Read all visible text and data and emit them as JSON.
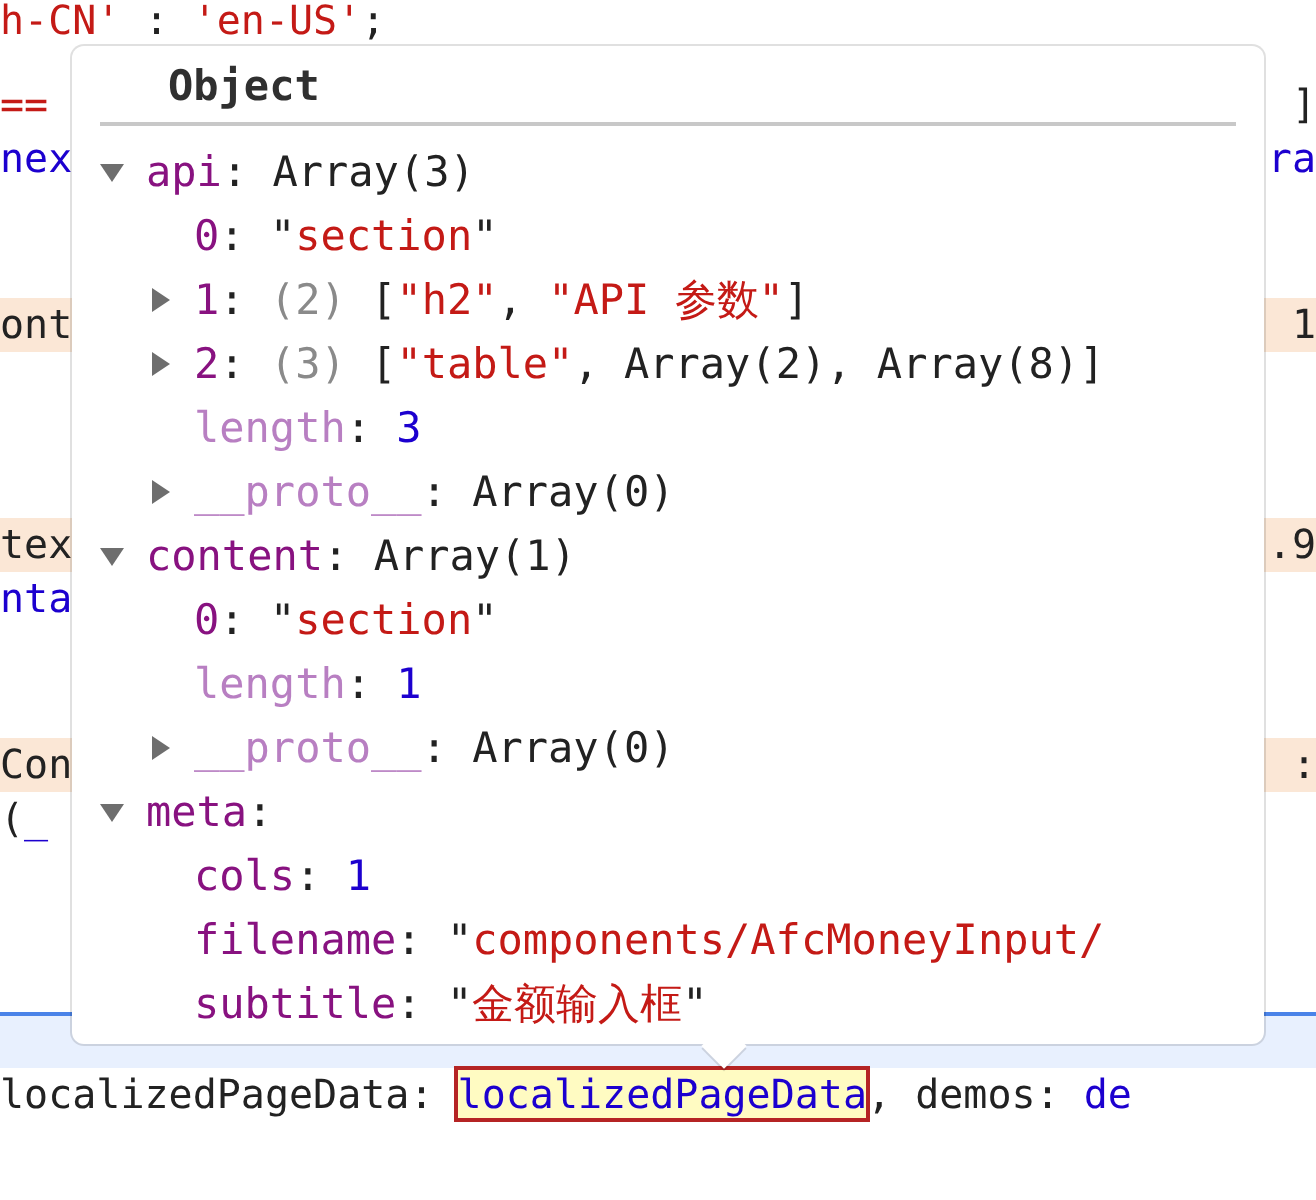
{
  "editor_lines": [
    {
      "kind": "plain",
      "left": [
        {
          "text": "h-CN'",
          "kind": "string"
        },
        {
          "text": " : ",
          "kind": "plain"
        },
        {
          "text": "'en-US'",
          "kind": "string"
        },
        {
          "text": ";",
          "kind": "plain"
        }
      ]
    },
    {
      "kind": "plain",
      "left": [
        {
          "text": "==",
          "kind": "string"
        }
      ],
      "right": [
        {
          "text": "]",
          "kind": "plain"
        }
      ]
    },
    {
      "kind": "plain",
      "left": [
        {
          "text": "nex",
          "kind": "ident"
        }
      ],
      "right": [
        {
          "text": "ra",
          "kind": "ident"
        }
      ]
    },
    {
      "kind": "plain"
    },
    {
      "kind": "plain"
    },
    {
      "kind": "changed",
      "left": [
        {
          "text": "ont",
          "kind": "plain"
        }
      ],
      "right": [
        {
          "text": "1",
          "kind": "plain"
        }
      ]
    },
    {
      "kind": "plain"
    },
    {
      "kind": "plain"
    },
    {
      "kind": "plain"
    },
    {
      "kind": "changed",
      "left": [
        {
          "text": "tex",
          "kind": "plain"
        }
      ],
      "right": [
        {
          "text": ".9",
          "kind": "plain"
        }
      ]
    },
    {
      "kind": "plain",
      "left": [
        {
          "text": "nta",
          "kind": "ident"
        }
      ]
    },
    {
      "kind": "plain"
    },
    {
      "kind": "plain"
    },
    {
      "kind": "changed",
      "left": [
        {
          "text": "Con",
          "kind": "plain"
        }
      ],
      "right": [
        {
          "text": ":",
          "kind": "plain"
        }
      ]
    },
    {
      "kind": "plain",
      "left": [
        {
          "text": "(",
          "kind": "plain"
        },
        {
          "text": "_",
          "kind": "ident"
        }
      ]
    },
    {
      "kind": "plain"
    },
    {
      "kind": "plain"
    },
    {
      "kind": "plain"
    },
    {
      "kind": "current"
    },
    {
      "kind": "plain",
      "left": [
        {
          "text": "localizedPageData: ",
          "kind": "plain"
        },
        {
          "text": "localizedPageData",
          "kind": "match"
        },
        {
          "text": ", demos: ",
          "kind": "plain"
        },
        {
          "text": "de",
          "kind": "ident"
        }
      ]
    }
  ],
  "popover": {
    "title": "Object",
    "properties": [
      {
        "key": "api",
        "internal": false,
        "value": [
          {
            "text": ": ",
            "kind": "plain"
          },
          {
            "text": "Array(3)",
            "kind": "plain"
          }
        ],
        "expanded": true,
        "children": [
          {
            "key": "0",
            "internal": false,
            "value": [
              {
                "text": ": \"",
                "kind": "plain"
              },
              {
                "text": "section",
                "kind": "string"
              },
              {
                "text": "\"",
                "kind": "plain"
              }
            ]
          },
          {
            "key": "1",
            "internal": false,
            "value": [
              {
                "text": ": ",
                "kind": "plain"
              },
              {
                "text": "(2) ",
                "kind": "dim"
              },
              {
                "text": "[",
                "kind": "plain"
              },
              {
                "text": "\"h2\"",
                "kind": "string"
              },
              {
                "text": ", ",
                "kind": "plain"
              },
              {
                "text": "\"API 参数\"",
                "kind": "string"
              },
              {
                "text": "]",
                "kind": "plain"
              }
            ],
            "expanded": false
          },
          {
            "key": "2",
            "internal": false,
            "value": [
              {
                "text": ": ",
                "kind": "plain"
              },
              {
                "text": "(3) ",
                "kind": "dim"
              },
              {
                "text": "[",
                "kind": "plain"
              },
              {
                "text": "\"table\"",
                "kind": "string"
              },
              {
                "text": ", Array(2), Array(8)]",
                "kind": "plain"
              }
            ],
            "expanded": false
          },
          {
            "key": "length",
            "internal": true,
            "value": [
              {
                "text": ": ",
                "kind": "plain"
              },
              {
                "text": "3",
                "kind": "number"
              }
            ]
          },
          {
            "key": "__proto__",
            "internal": true,
            "value": [
              {
                "text": ": ",
                "kind": "plain"
              },
              {
                "text": "Array(0)",
                "kind": "plain"
              }
            ],
            "expanded": false
          }
        ]
      },
      {
        "key": "content",
        "internal": false,
        "value": [
          {
            "text": ": ",
            "kind": "plain"
          },
          {
            "text": "Array(1)",
            "kind": "plain"
          }
        ],
        "expanded": true,
        "children": [
          {
            "key": "0",
            "internal": false,
            "value": [
              {
                "text": ": \"",
                "kind": "plain"
              },
              {
                "text": "section",
                "kind": "string"
              },
              {
                "text": "\"",
                "kind": "plain"
              }
            ]
          },
          {
            "key": "length",
            "internal": true,
            "value": [
              {
                "text": ": ",
                "kind": "plain"
              },
              {
                "text": "1",
                "kind": "number"
              }
            ]
          },
          {
            "key": "__proto__",
            "internal": true,
            "value": [
              {
                "text": ": ",
                "kind": "plain"
              },
              {
                "text": "Array(0)",
                "kind": "plain"
              }
            ],
            "expanded": false
          }
        ]
      },
      {
        "key": "meta",
        "internal": false,
        "value": [
          {
            "text": ":",
            "kind": "plain"
          }
        ],
        "expanded": true,
        "children": [
          {
            "key": "cols",
            "internal": false,
            "value": [
              {
                "text": ": ",
                "kind": "plain"
              },
              {
                "text": "1",
                "kind": "number"
              }
            ]
          },
          {
            "key": "filename",
            "internal": false,
            "value": [
              {
                "text": ": \"",
                "kind": "plain"
              },
              {
                "text": "components/AfcMoneyInput/",
                "kind": "string"
              }
            ]
          },
          {
            "key": "subtitle",
            "internal": false,
            "value": [
              {
                "text": ": \"",
                "kind": "plain"
              },
              {
                "text": "金额输入框",
                "kind": "string"
              },
              {
                "text": "\"",
                "kind": "plain"
              }
            ]
          }
        ]
      }
    ]
  }
}
